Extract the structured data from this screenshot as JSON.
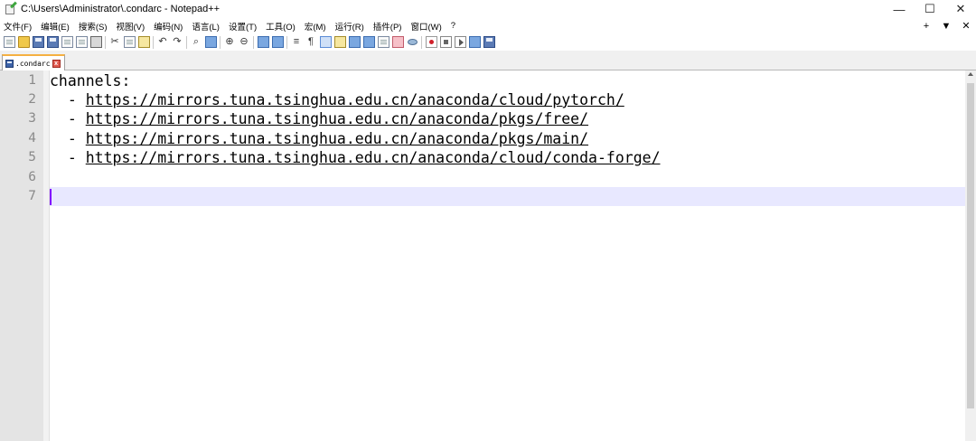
{
  "window": {
    "title": "C:\\Users\\Administrator\\.condarc - Notepad++",
    "controls": {
      "minimize": "—",
      "maximize": "☐",
      "close": "✕"
    }
  },
  "menubar": {
    "items": [
      {
        "label": "文件(F)"
      },
      {
        "label": "编辑(E)"
      },
      {
        "label": "搜索(S)"
      },
      {
        "label": "视图(V)"
      },
      {
        "label": "编码(N)"
      },
      {
        "label": "语言(L)"
      },
      {
        "label": "设置(T)"
      },
      {
        "label": "工具(O)"
      },
      {
        "label": "宏(M)"
      },
      {
        "label": "运行(R)"
      },
      {
        "label": "插件(P)"
      },
      {
        "label": "窗口(W)"
      },
      {
        "label": "?"
      }
    ],
    "right": {
      "plus": "+",
      "dropdown": "▼",
      "close": "✕"
    }
  },
  "toolbar": {
    "icons": [
      "new-file",
      "open-file",
      "save",
      "save-all",
      "close",
      "close-all",
      "print",
      "cut",
      "copy",
      "paste",
      "undo",
      "redo",
      "find",
      "replace",
      "zoom-in",
      "zoom-out",
      "sync-vertical",
      "sync-horizontal",
      "word-wrap",
      "show-all-chars",
      "indent-guide",
      "user-lang",
      "doc-map",
      "function-list",
      "folder-workspace",
      "monitoring",
      "start-record",
      "stop-record",
      "play-macro",
      "run-macro-multiple",
      "save-macro"
    ]
  },
  "tabs": [
    {
      "label": ".condarc",
      "active": true
    }
  ],
  "editor": {
    "lines": [
      {
        "num": "1",
        "text": "channels:",
        "url": ""
      },
      {
        "num": "2",
        "text": "  - ",
        "url": "https://mirrors.tuna.tsinghua.edu.cn/anaconda/cloud/pytorch/"
      },
      {
        "num": "3",
        "text": "  - ",
        "url": "https://mirrors.tuna.tsinghua.edu.cn/anaconda/pkgs/free/"
      },
      {
        "num": "4",
        "text": "  - ",
        "url": "https://mirrors.tuna.tsinghua.edu.cn/anaconda/pkgs/main/"
      },
      {
        "num": "5",
        "text": "  - ",
        "url": "https://mirrors.tuna.tsinghua.edu.cn/anaconda/cloud/conda-forge/"
      },
      {
        "num": "6",
        "text": "",
        "url": ""
      },
      {
        "num": "7",
        "text": "",
        "url": ""
      }
    ],
    "current_line": "7",
    "colors": {
      "gutter": "#e4e4e4",
      "line_number": "#8a8a8a",
      "current_line": "#e8e8ff",
      "caret": "#8000ff"
    }
  }
}
